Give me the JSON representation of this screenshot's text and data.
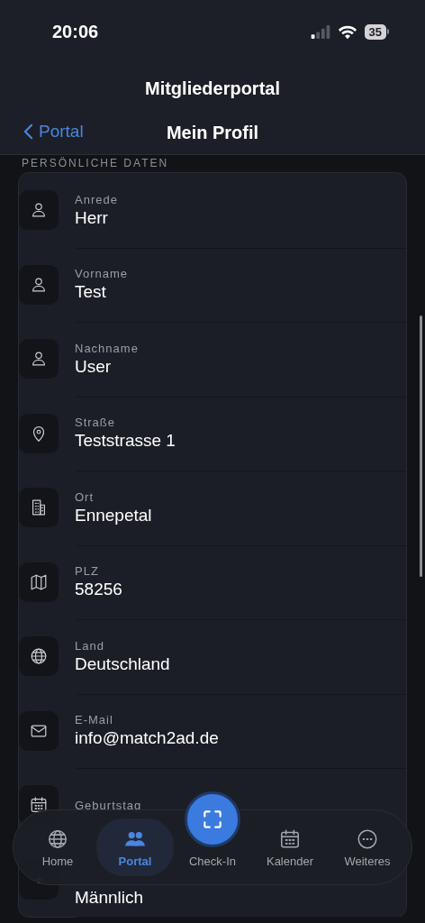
{
  "status_bar": {
    "time": "20:06",
    "battery": "35"
  },
  "header": {
    "app_title": "Mitgliederportal",
    "back_label": "Portal",
    "title": "Mein Profil"
  },
  "section": {
    "title": "PERSÖNLICHE DATEN",
    "fields": [
      {
        "label": "Anrede",
        "value": "Herr"
      },
      {
        "label": "Vorname",
        "value": "Test"
      },
      {
        "label": "Nachname",
        "value": "User"
      },
      {
        "label": "Straße",
        "value": "Teststrasse 1"
      },
      {
        "label": "Ort",
        "value": "Ennepetal"
      },
      {
        "label": "PLZ",
        "value": "58256"
      },
      {
        "label": "Land",
        "value": "Deutschland"
      },
      {
        "label": "E-Mail",
        "value": "info@match2ad.de"
      },
      {
        "label": "Geburtstag"
      },
      {
        "value": "Männlich"
      }
    ]
  },
  "tab_bar": [
    {
      "kind": "tab",
      "label": "Home",
      "selected": false
    },
    {
      "kind": "tab",
      "label": "Portal",
      "selected": true
    },
    {
      "kind": "action",
      "label": "Check-In",
      "selected": false
    },
    {
      "kind": "tab",
      "label": "Kalender",
      "selected": false
    },
    {
      "kind": "tab",
      "label": "Weiteres",
      "selected": false
    }
  ]
}
